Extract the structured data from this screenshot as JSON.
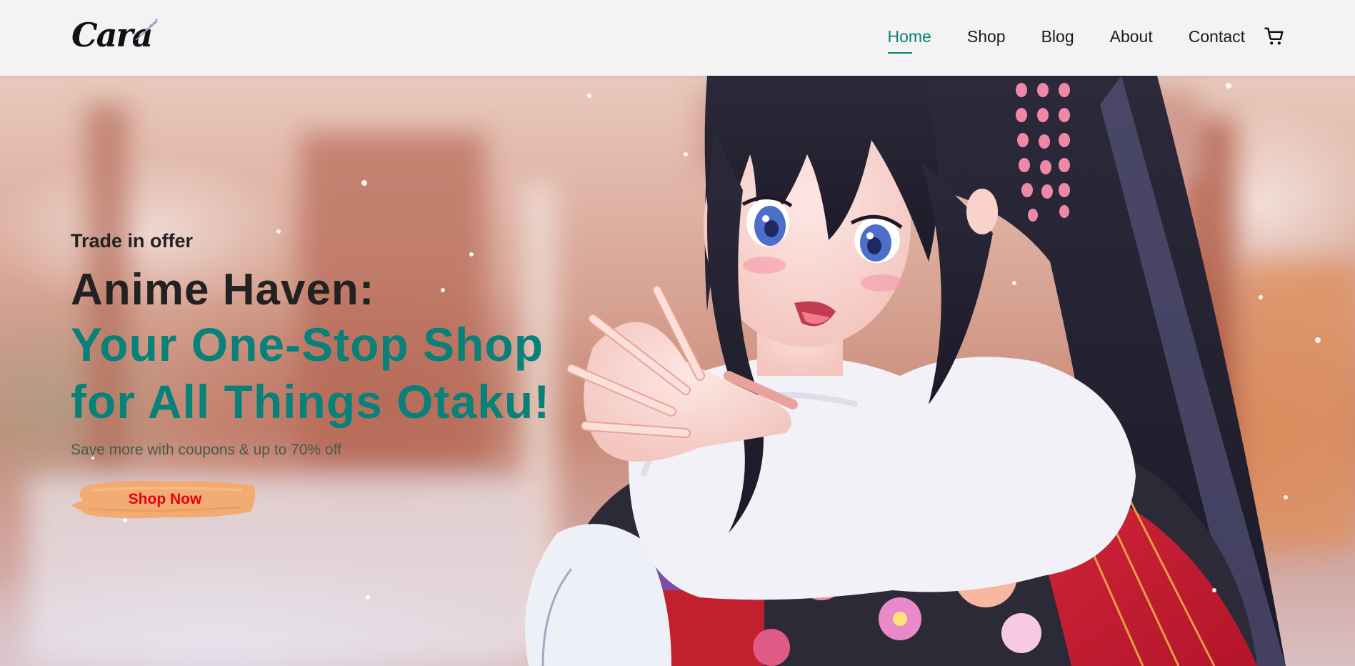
{
  "header": {
    "logo_text": "Cara",
    "nav": [
      {
        "label": "Home",
        "active": true
      },
      {
        "label": "Shop",
        "active": false
      },
      {
        "label": "Blog",
        "active": false
      },
      {
        "label": "About",
        "active": false
      },
      {
        "label": "Contact",
        "active": false
      }
    ],
    "cart_icon": "shopping-cart-icon"
  },
  "hero": {
    "eyebrow": "Trade in offer",
    "title_line1": "Anime Haven:",
    "title_line2": "Your One-Stop Shop",
    "title_line3": "for All Things Otaku!",
    "subtitle": "Save more with coupons & up to 70% off",
    "cta_label": "Shop Now",
    "image_subject": "anime girl in kimono"
  },
  "colors": {
    "accent": "#088178",
    "cta_text": "#e80012",
    "cta_brush": "#f3a86a",
    "header_bg": "#f3f3f3"
  }
}
